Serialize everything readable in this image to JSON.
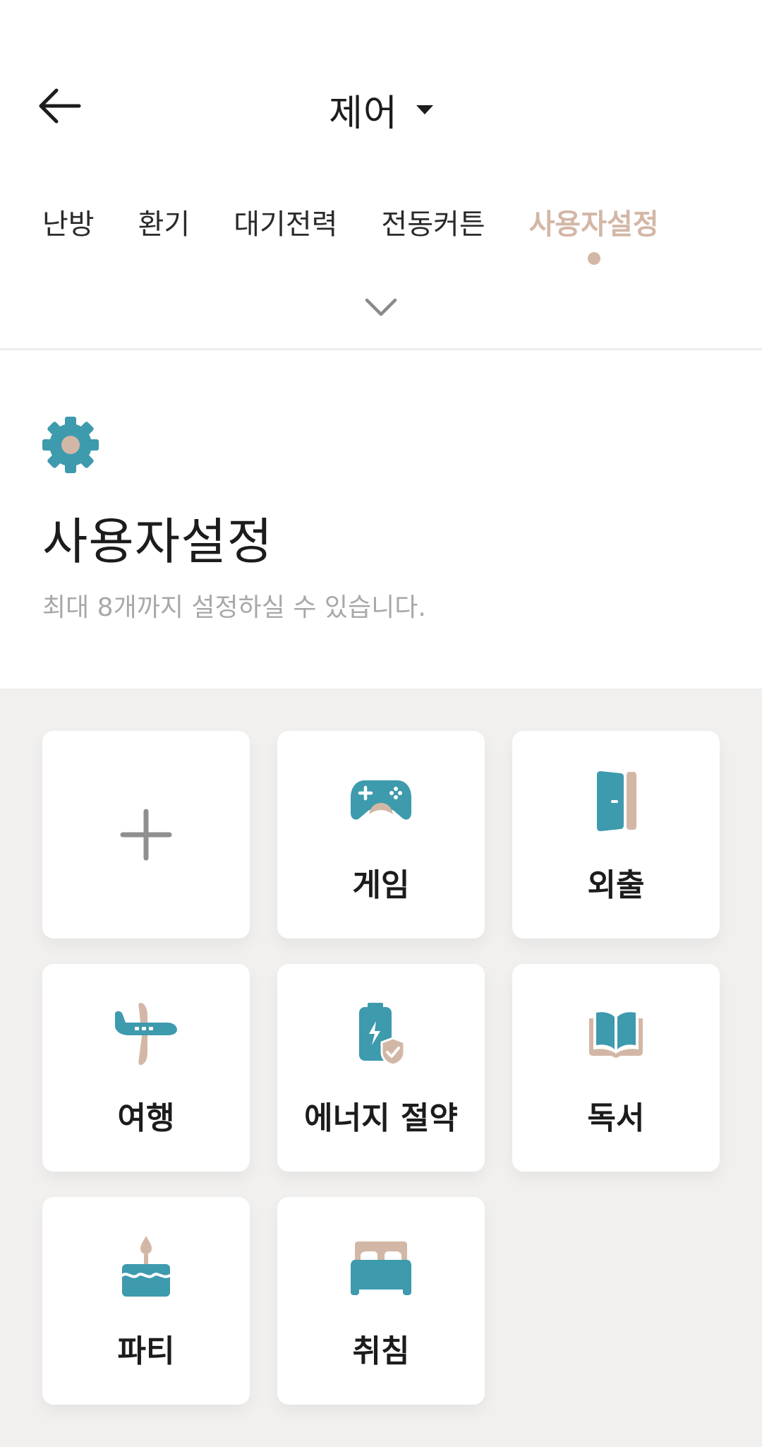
{
  "header": {
    "title": "제어"
  },
  "tabs": [
    {
      "label": "난방",
      "active": false
    },
    {
      "label": "환기",
      "active": false
    },
    {
      "label": "대기전력",
      "active": false
    },
    {
      "label": "전동커튼",
      "active": false
    },
    {
      "label": "사용자설정",
      "active": true
    }
  ],
  "section": {
    "icon": "gear-icon",
    "title": "사용자설정",
    "subtitle": "최대 8개까지 설정하실 수 있습니다."
  },
  "colors": {
    "accent_teal": "#3e9aad",
    "accent_beige": "#d3b7a6",
    "background_grey": "#f1f0ef",
    "text_dark": "#1c1c1c",
    "text_sub": "#a8a8a8"
  },
  "grid": {
    "add_icon": "plus-icon",
    "items": [
      {
        "label": "게임",
        "icon": "gamepad-icon"
      },
      {
        "label": "외출",
        "icon": "door-icon"
      },
      {
        "label": "여행",
        "icon": "airplane-icon"
      },
      {
        "label": "에너지 절약",
        "icon": "battery-shield-icon"
      },
      {
        "label": "독서",
        "icon": "book-icon"
      },
      {
        "label": "파티",
        "icon": "cake-icon"
      },
      {
        "label": "취침",
        "icon": "bed-icon"
      }
    ]
  }
}
